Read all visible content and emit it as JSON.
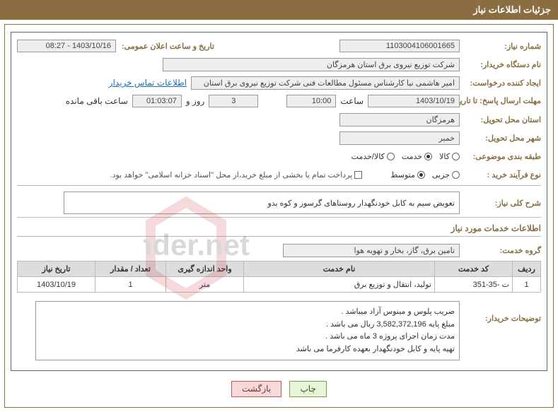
{
  "title_bar": "جزئیات اطلاعات نیاز",
  "labels": {
    "need_no": "شماره نیاز:",
    "announce_dt": "تاریخ و ساعت اعلان عمومی:",
    "buyer_org": "نام دستگاه خریدار:",
    "requester": "ایجاد کننده درخواست:",
    "buyer_contact_link": "اطلاعات تماس خریدار",
    "reply_deadline": "مهلت ارسال پاسخ: تا تاریخ:",
    "hour_word": "ساعت",
    "days_and": "روز و",
    "remaining": "ساعت باقی مانده",
    "province": "استان محل تحویل:",
    "city": "شهر محل تحویل:",
    "category": "طبقه بندی موضوعی:",
    "cat_goods": "کالا",
    "cat_service": "خدمت",
    "cat_both": "کالا/خدمت",
    "purchase_type": "نوع فرآیند خرید :",
    "ptype_minor": "جزیی",
    "ptype_medium": "متوسط",
    "treasury_note": "پرداخت تمام یا بخشی از مبلغ خرید،از محل \"اسناد خزانه اسلامی\" خواهد بود.",
    "need_summary_lbl": "شرح کلی نیاز:",
    "services_sec": "اطلاعات خدمات مورد نیاز",
    "service_group_lbl": "گروه خدمت:",
    "buyer_notes_lbl": "توضیحات خریدار:",
    "print_btn": "چاپ",
    "back_btn": "بازگشت"
  },
  "values": {
    "need_no": "1103004106001665",
    "announce_dt": "1403/10/16 - 08:27",
    "buyer_org": "شرکت توزیع نیروی برق استان هرمزگان",
    "requester": "امیر هاشمی نیا کارشناس مسئول مطالعات فنی شرکت توزیع نیروی برق استان",
    "reply_date": "1403/10/19",
    "reply_time": "10:00",
    "days_left": "3",
    "time_left": "01:03:07",
    "province": "هرمزگان",
    "city": "خمیر",
    "need_summary": "تعویض سیم به کابل خودنگهدار روستاهای گرسوز و کوه بدو",
    "service_group": "تامین برق، گاز، بخار و تهویه هوا"
  },
  "radios": {
    "category_checked": "service",
    "ptype_checked": "medium",
    "treasury_checked": false
  },
  "table": {
    "headers": {
      "row": "ردیف",
      "code": "کد خدمت",
      "name": "نام خدمت",
      "unit": "واحد اندازه گیری",
      "qty": "تعداد / مقدار",
      "need_date": "تاریخ نیاز"
    },
    "rows": [
      {
        "row": "1",
        "code": "ت -35-351",
        "name": "تولید، انتقال و توزیع برق",
        "unit": "متر",
        "qty": "1",
        "need_date": "1403/10/19"
      }
    ]
  },
  "buyer_notes": [
    "ضریب پلوس و مینوس آزاد میباشد .",
    "مبلغ پایه 3,582,372,196  ریال می باشد .",
    "مدت زمان اجرای پروژه 3 ماه می باشد .",
    "تهیه پایه و  کابل خودنگهدار بعهده کارفرما می باشد"
  ],
  "watermark": "AriaTender.net"
}
